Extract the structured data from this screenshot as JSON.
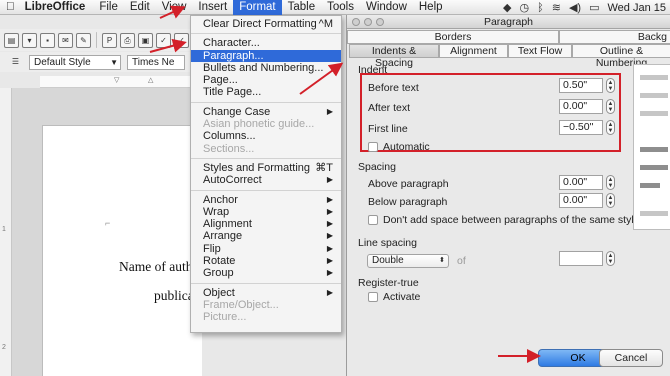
{
  "menubar": {
    "apple": "",
    "app": "LibreOffice",
    "items": [
      "File",
      "Edit",
      "View",
      "Insert",
      "Format",
      "Table",
      "Tools",
      "Window",
      "Help"
    ],
    "active": "Format",
    "clock": "Wed Jan 15",
    "status_icons": [
      "wifi-icon",
      "volume-icon",
      "battery-icon",
      "user-icon"
    ]
  },
  "toolbar": {
    "style_value": "Default Style",
    "font_value": "Times Ne"
  },
  "document": {
    "line1": "Name of autho",
    "line2": "publica"
  },
  "format_menu": {
    "items": [
      {
        "label": "Clear Direct Formatting",
        "shortcut": "^M"
      },
      {
        "sep": true
      },
      {
        "label": "Character..."
      },
      {
        "label": "Paragraph...",
        "highlighted": true
      },
      {
        "label": "Bullets and Numbering..."
      },
      {
        "label": "Page..."
      },
      {
        "label": "Title Page..."
      },
      {
        "sep": true
      },
      {
        "label": "Change Case",
        "submenu": true
      },
      {
        "label": "Asian phonetic guide...",
        "disabled": true
      },
      {
        "label": "Columns..."
      },
      {
        "label": "Sections...",
        "disabled": true
      },
      {
        "sep": true
      },
      {
        "label": "Styles and Formatting",
        "shortcut": "⌘T"
      },
      {
        "label": "AutoCorrect",
        "submenu": true
      },
      {
        "sep": true
      },
      {
        "label": "Anchor",
        "submenu": true
      },
      {
        "label": "Wrap",
        "submenu": true
      },
      {
        "label": "Alignment",
        "submenu": true
      },
      {
        "label": "Arrange",
        "submenu": true
      },
      {
        "label": "Flip",
        "submenu": true
      },
      {
        "label": "Rotate",
        "submenu": true
      },
      {
        "label": "Group",
        "submenu": true
      },
      {
        "sep": true
      },
      {
        "label": "Object",
        "submenu": true
      },
      {
        "label": "Frame/Object...",
        "disabled": true
      },
      {
        "label": "Picture...",
        "disabled": true
      }
    ]
  },
  "dialog": {
    "title": "Paragraph",
    "tabs_back": [
      "Borders",
      "Backg"
    ],
    "tabs_front": [
      "Indents & Spacing",
      "Alignment",
      "Text Flow",
      "Outline & Numbering"
    ],
    "active_tab": "Indents & Spacing",
    "indent": {
      "section": "Indent",
      "before_text_label": "Before text",
      "before_text_value": "0.50\"",
      "after_text_label": "After text",
      "after_text_value": "0.00\"",
      "first_line_label": "First line",
      "first_line_value": "−0.50\"",
      "automatic_label": "Automatic"
    },
    "spacing": {
      "section": "Spacing",
      "above_label": "Above paragraph",
      "above_value": "0.00\"",
      "below_label": "Below paragraph",
      "below_value": "0.00\"",
      "dont_add_label": "Don't add space between paragraphs of the same style"
    },
    "line_spacing": {
      "section": "Line spacing",
      "value": "Double",
      "of_label": "of",
      "of_value": ""
    },
    "register": {
      "section": "Register-true",
      "activate_label": "Activate"
    },
    "ok_label": "OK",
    "cancel_label": "Cancel"
  },
  "colors": {
    "menu_highlight": "#2f6ad9",
    "annotation_red": "#d32029"
  }
}
